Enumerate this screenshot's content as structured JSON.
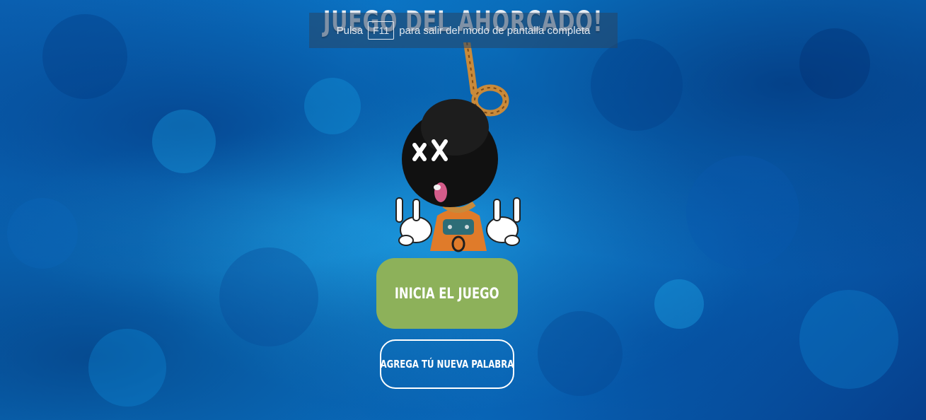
{
  "page": {
    "title": "JUEGO DEL AHORCADO!"
  },
  "fullscreen_notice": {
    "prefix": "Pulsa",
    "key": "F11",
    "suffix": "para salir del modo de pantalla completa"
  },
  "illustration": {
    "icon": "hanged-man-illustration"
  },
  "buttons": {
    "start_label": "INICIA EL JUEGO",
    "add_word_label": "AGREGA TÚ NUEVA PALABRA"
  },
  "colors": {
    "background": "#0b7ccc",
    "start_button": "#8db15a",
    "text": "#ffffff"
  }
}
